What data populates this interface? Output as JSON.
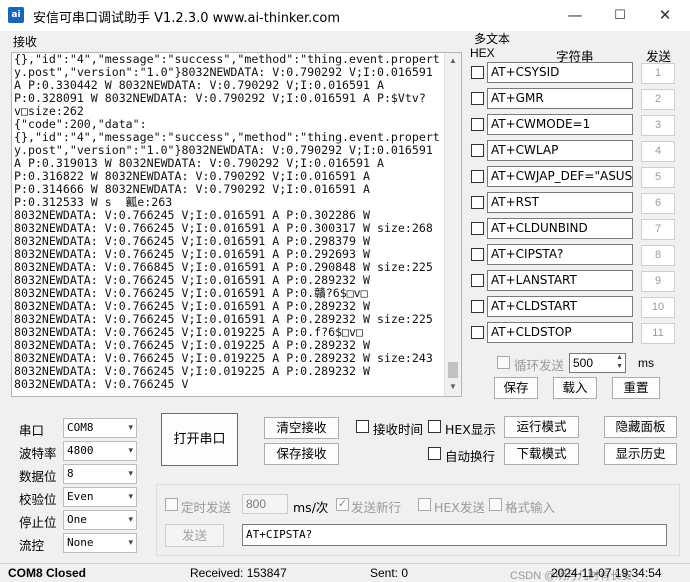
{
  "window": {
    "title": "安信可串口调试助手 V1.2.3.0    www.ai-thinker.com",
    "icon_text": "ai",
    "minimize": "—",
    "maximize": "☐",
    "close": "✕"
  },
  "receive": {
    "label": "接收",
    "lines": [
      "{},\"id\":\"4\",\"message\":\"success\",\"method\":\"thing.event.propert",
      "y.post\",\"version\":\"1.0\"}8032NEWDATA: V:0.790292 V;I:0.016591",
      "A P:0.330442 W 8032NEWDATA: V:0.790292 V;I:0.016591 A",
      "P:0.328091 W 8032NEWDATA: V:0.790292 V;I:0.016591 A P:$Vtv?",
      "v□size:262",
      "{\"code\":200,\"data\":",
      "{},\"id\":\"4\",\"message\":\"success\",\"method\":\"thing.event.propert",
      "y.post\",\"version\":\"1.0\"}8032NEWDATA: V:0.790292 V;I:0.016591",
      "A P:0.319013 W 8032NEWDATA: V:0.790292 V;I:0.016591 A",
      "P:0.316822 W 8032NEWDATA: V:0.790292 V;I:0.016591 A",
      "P:0.314666 W 8032NEWDATA: V:0.790292 V;I:0.016591 A",
      "P:0.312533 W s  瓤e:263",
      "8032NEWDATA: V:0.766245 V;I:0.016591 A P:0.302286 W",
      "8032NEWDATA: V:0.766245 V;I:0.016591 A P:0.300317 W size:268",
      "8032NEWDATA: V:0.766245 V;I:0.016591 A P:0.298379 W",
      "8032NEWDATA: V:0.766245 V;I:0.016591 A P:0.292693 W",
      "8032NEWDATA: V:0.766845 V;I:0.016591 A P:0.290848 W size:225",
      "8032NEWDATA: V:0.766245 V;I:0.016591 A P:0.289232 W",
      "8032NEWDATA: V:0.766245 V;I:0.016591 A P:0.贛?6$□v□",
      "8032NEWDATA: V:0.766245 V;I:0.016591 A P:0.289232 W",
      "8032NEWDATA: V:0.766245 V;I:0.016591 A P:0.289232 W size:225",
      "8032NEWDATA: V:0.766245 V;I:0.019225 A P:0.f?6$□v□",
      "8032NEWDATA: V:0.766245 V;I:0.019225 A P:0.289232 W",
      "8032NEWDATA: V:0.766245 V;I:0.019225 A P:0.289232 W size:243",
      "8032NEWDATA: V:0.766245 V;I:0.019225 A P:0.289232 W",
      "8032NEWDATA: V:0.766245 V"
    ],
    "scroll_up": "▲",
    "scroll_down": "▼"
  },
  "multitext": {
    "label": "多文本",
    "col_hex": "HEX",
    "col_string": "字符串",
    "col_send": "发送",
    "rows": [
      {
        "text": "AT+CSYSID",
        "num": "1"
      },
      {
        "text": "AT+GMR",
        "num": "2"
      },
      {
        "text": "AT+CWMODE=1",
        "num": "3"
      },
      {
        "text": "AT+CWLAP",
        "num": "4"
      },
      {
        "text": "AT+CWJAP_DEF=\"ASUS\",",
        "num": "5"
      },
      {
        "text": "AT+RST",
        "num": "6"
      },
      {
        "text": "AT+CLDUNBIND",
        "num": "7"
      },
      {
        "text": "AT+CIPSTA?",
        "num": "8"
      },
      {
        "text": "AT+LANSTART",
        "num": "9"
      },
      {
        "text": "AT+CLDSTART",
        "num": "10"
      },
      {
        "text": "AT+CLDSTOP",
        "num": "11"
      }
    ],
    "loop_send_label": "循环发送",
    "loop_interval": "500",
    "loop_unit": "ms",
    "save_label": "保存",
    "load_label": "载入",
    "reset_label": "重置"
  },
  "serial": {
    "port_label": "串口",
    "port_value": "COM8",
    "baud_label": "波特率",
    "baud_value": "4800",
    "databits_label": "数据位",
    "databits_value": "8",
    "parity_label": "校验位",
    "parity_value": "Even",
    "stopbits_label": "停止位",
    "stopbits_value": "One",
    "flow_label": "流控",
    "flow_value": "None",
    "open_button": "打开串口",
    "dropdown_arrow": "▾"
  },
  "actions": {
    "clear_recv": "清空接收",
    "save_recv": "保存接收",
    "recv_time": "接收时间",
    "hex_display": "HEX显示",
    "auto_wrap": "自动换行",
    "run_mode": "运行模式",
    "download_mode": "下载模式",
    "hide_panel": "隐藏面板",
    "show_history": "显示历史"
  },
  "send": {
    "timed_send": "定时发送",
    "interval_value": "800",
    "interval_unit": "ms/次",
    "send_newline": "发送新行",
    "hex_send": "HEX发送",
    "format_input": "格式输入",
    "send_button": "发送",
    "input_value": "AT+CIPSTA?",
    "newline_check": "✓"
  },
  "status": {
    "port_state": "COM8 Closed",
    "received": "Received: 153847",
    "sent": "Sent: 0",
    "datetime": "2024-11-07 19:34:54",
    "watermark": "CSDN @明月几时有长安"
  }
}
